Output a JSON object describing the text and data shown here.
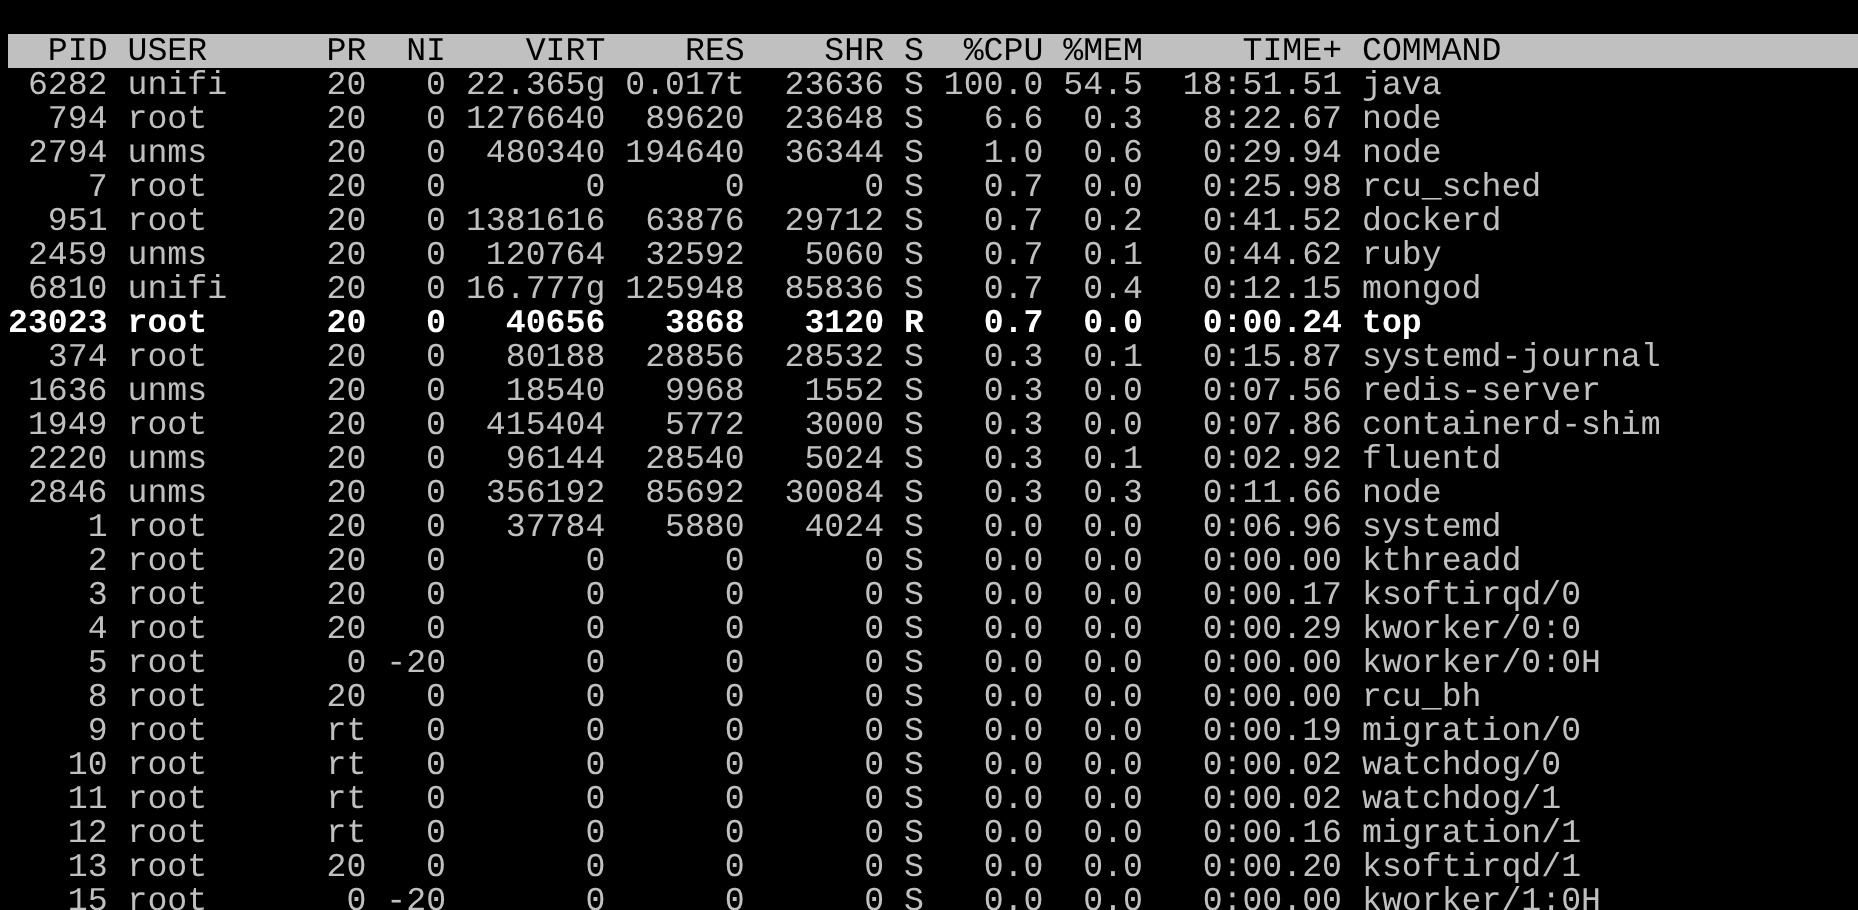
{
  "columns": [
    "PID",
    "USER",
    "PR",
    "NI",
    "VIRT",
    "RES",
    "SHR",
    "S",
    "%CPU",
    "%MEM",
    "TIME+",
    "COMMAND"
  ],
  "rows": [
    {
      "cells": [
        "6282",
        "unifi",
        "20",
        "0",
        "22.365g",
        "0.017t",
        "23636",
        "S",
        "100.0",
        "54.5",
        "18:51.51",
        "java"
      ],
      "highlighted": false
    },
    {
      "cells": [
        "794",
        "root",
        "20",
        "0",
        "1276640",
        "89620",
        "23648",
        "S",
        "6.6",
        "0.3",
        "8:22.67",
        "node"
      ],
      "highlighted": false
    },
    {
      "cells": [
        "2794",
        "unms",
        "20",
        "0",
        "480340",
        "194640",
        "36344",
        "S",
        "1.0",
        "0.6",
        "0:29.94",
        "node"
      ],
      "highlighted": false
    },
    {
      "cells": [
        "7",
        "root",
        "20",
        "0",
        "0",
        "0",
        "0",
        "S",
        "0.7",
        "0.0",
        "0:25.98",
        "rcu_sched"
      ],
      "highlighted": false
    },
    {
      "cells": [
        "951",
        "root",
        "20",
        "0",
        "1381616",
        "63876",
        "29712",
        "S",
        "0.7",
        "0.2",
        "0:41.52",
        "dockerd"
      ],
      "highlighted": false
    },
    {
      "cells": [
        "2459",
        "unms",
        "20",
        "0",
        "120764",
        "32592",
        "5060",
        "S",
        "0.7",
        "0.1",
        "0:44.62",
        "ruby"
      ],
      "highlighted": false
    },
    {
      "cells": [
        "6810",
        "unifi",
        "20",
        "0",
        "16.777g",
        "125948",
        "85836",
        "S",
        "0.7",
        "0.4",
        "0:12.15",
        "mongod"
      ],
      "highlighted": false
    },
    {
      "cells": [
        "23023",
        "root",
        "20",
        "0",
        "40656",
        "3868",
        "3120",
        "R",
        "0.7",
        "0.0",
        "0:00.24",
        "top"
      ],
      "highlighted": true
    },
    {
      "cells": [
        "374",
        "root",
        "20",
        "0",
        "80188",
        "28856",
        "28532",
        "S",
        "0.3",
        "0.1",
        "0:15.87",
        "systemd-journal"
      ],
      "highlighted": false
    },
    {
      "cells": [
        "1636",
        "unms",
        "20",
        "0",
        "18540",
        "9968",
        "1552",
        "S",
        "0.3",
        "0.0",
        "0:07.56",
        "redis-server"
      ],
      "highlighted": false
    },
    {
      "cells": [
        "1949",
        "root",
        "20",
        "0",
        "415404",
        "5772",
        "3000",
        "S",
        "0.3",
        "0.0",
        "0:07.86",
        "containerd-shim"
      ],
      "highlighted": false
    },
    {
      "cells": [
        "2220",
        "unms",
        "20",
        "0",
        "96144",
        "28540",
        "5024",
        "S",
        "0.3",
        "0.1",
        "0:02.92",
        "fluentd"
      ],
      "highlighted": false
    },
    {
      "cells": [
        "2846",
        "unms",
        "20",
        "0",
        "356192",
        "85692",
        "30084",
        "S",
        "0.3",
        "0.3",
        "0:11.66",
        "node"
      ],
      "highlighted": false
    },
    {
      "cells": [
        "1",
        "root",
        "20",
        "0",
        "37784",
        "5880",
        "4024",
        "S",
        "0.0",
        "0.0",
        "0:06.96",
        "systemd"
      ],
      "highlighted": false
    },
    {
      "cells": [
        "2",
        "root",
        "20",
        "0",
        "0",
        "0",
        "0",
        "S",
        "0.0",
        "0.0",
        "0:00.00",
        "kthreadd"
      ],
      "highlighted": false
    },
    {
      "cells": [
        "3",
        "root",
        "20",
        "0",
        "0",
        "0",
        "0",
        "S",
        "0.0",
        "0.0",
        "0:00.17",
        "ksoftirqd/0"
      ],
      "highlighted": false
    },
    {
      "cells": [
        "4",
        "root",
        "20",
        "0",
        "0",
        "0",
        "0",
        "S",
        "0.0",
        "0.0",
        "0:00.29",
        "kworker/0:0"
      ],
      "highlighted": false
    },
    {
      "cells": [
        "5",
        "root",
        "0",
        "-20",
        "0",
        "0",
        "0",
        "S",
        "0.0",
        "0.0",
        "0:00.00",
        "kworker/0:0H"
      ],
      "highlighted": false
    },
    {
      "cells": [
        "8",
        "root",
        "20",
        "0",
        "0",
        "0",
        "0",
        "S",
        "0.0",
        "0.0",
        "0:00.00",
        "rcu_bh"
      ],
      "highlighted": false
    },
    {
      "cells": [
        "9",
        "root",
        "rt",
        "0",
        "0",
        "0",
        "0",
        "S",
        "0.0",
        "0.0",
        "0:00.19",
        "migration/0"
      ],
      "highlighted": false
    },
    {
      "cells": [
        "10",
        "root",
        "rt",
        "0",
        "0",
        "0",
        "0",
        "S",
        "0.0",
        "0.0",
        "0:00.02",
        "watchdog/0"
      ],
      "highlighted": false
    },
    {
      "cells": [
        "11",
        "root",
        "rt",
        "0",
        "0",
        "0",
        "0",
        "S",
        "0.0",
        "0.0",
        "0:00.02",
        "watchdog/1"
      ],
      "highlighted": false
    },
    {
      "cells": [
        "12",
        "root",
        "rt",
        "0",
        "0",
        "0",
        "0",
        "S",
        "0.0",
        "0.0",
        "0:00.16",
        "migration/1"
      ],
      "highlighted": false
    },
    {
      "cells": [
        "13",
        "root",
        "20",
        "0",
        "0",
        "0",
        "0",
        "S",
        "0.0",
        "0.0",
        "0:00.20",
        "ksoftirqd/1"
      ],
      "highlighted": false
    },
    {
      "cells": [
        "15",
        "root",
        "0",
        "-20",
        "0",
        "0",
        "0",
        "S",
        "0.0",
        "0.0",
        "0:00.00",
        "kworker/1:0H"
      ],
      "highlighted": false
    }
  ]
}
